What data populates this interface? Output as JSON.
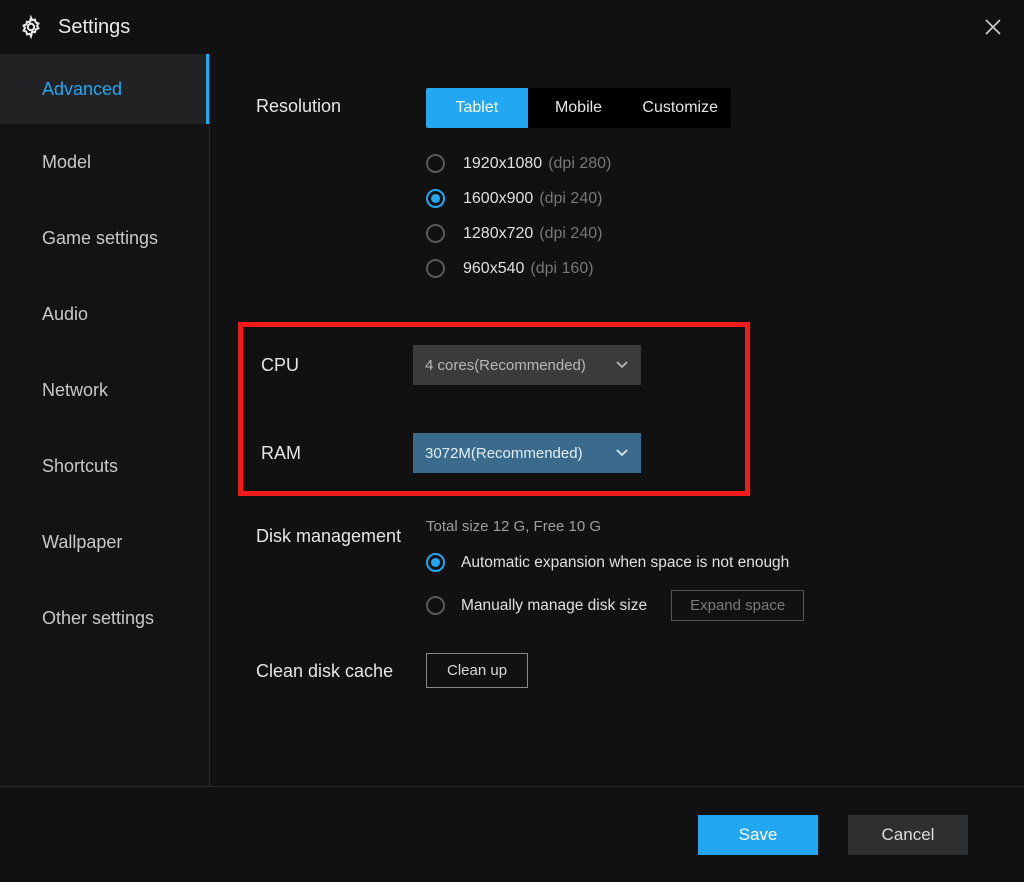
{
  "header": {
    "title": "Settings"
  },
  "sidebar": {
    "items": [
      {
        "label": "Advanced",
        "active": true
      },
      {
        "label": "Model",
        "active": false
      },
      {
        "label": "Game settings",
        "active": false
      },
      {
        "label": "Audio",
        "active": false
      },
      {
        "label": "Network",
        "active": false
      },
      {
        "label": "Shortcuts",
        "active": false
      },
      {
        "label": "Wallpaper",
        "active": false
      },
      {
        "label": "Other settings",
        "active": false
      }
    ]
  },
  "resolution": {
    "label": "Resolution",
    "tabs": [
      {
        "label": "Tablet",
        "active": true
      },
      {
        "label": "Mobile",
        "active": false
      },
      {
        "label": "Customize",
        "active": false
      }
    ],
    "options": [
      {
        "res": "1920x1080",
        "dpi": "(dpi 280)",
        "selected": false
      },
      {
        "res": "1600x900",
        "dpi": "(dpi 240)",
        "selected": true
      },
      {
        "res": "1280x720",
        "dpi": "(dpi 240)",
        "selected": false
      },
      {
        "res": "960x540",
        "dpi": "(dpi 160)",
        "selected": false
      }
    ]
  },
  "cpu": {
    "label": "CPU",
    "value": "4 cores(Recommended)"
  },
  "ram": {
    "label": "RAM",
    "value": "3072M(Recommended)"
  },
  "disk": {
    "label": "Disk management",
    "status": "Total size 12 G,  Free 10 G",
    "options": [
      {
        "label": "Automatic expansion when space is not enough",
        "selected": true
      },
      {
        "label": "Manually manage disk size",
        "selected": false
      }
    ],
    "expand_label": "Expand space"
  },
  "clean": {
    "label": "Clean disk cache",
    "button": "Clean up"
  },
  "footer": {
    "save": "Save",
    "cancel": "Cancel"
  }
}
